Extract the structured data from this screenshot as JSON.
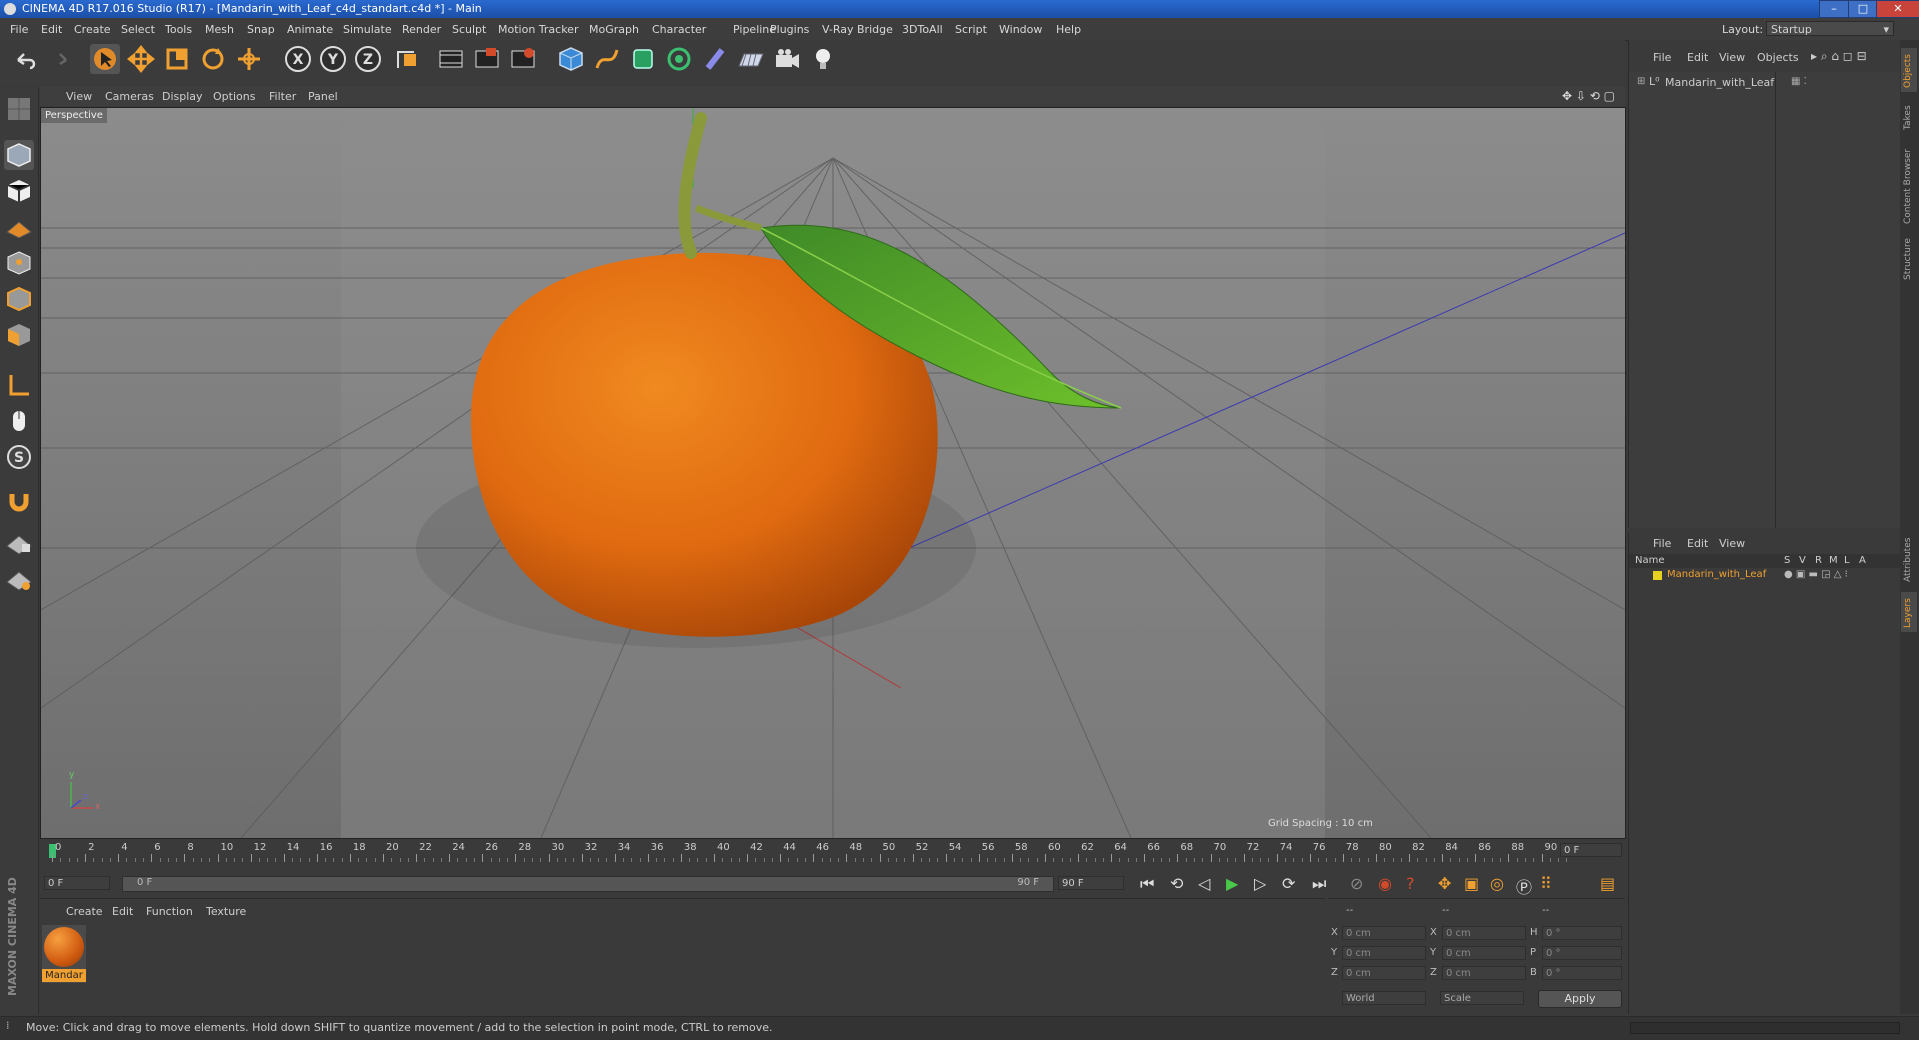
{
  "window": {
    "title": "CINEMA 4D R17.016 Studio (R17) - [Mandarin_with_Leaf_c4d_standart.c4d *] - Main",
    "minimize": "–",
    "maximize": "□",
    "close": "✕"
  },
  "menu": [
    "File",
    "Edit",
    "Create",
    "Select",
    "Tools",
    "Mesh",
    "Snap",
    "Animate",
    "Simulate",
    "Render",
    "Sculpt",
    "Motion Tracker",
    "MoGraph",
    "Character",
    "Pipeline",
    "Plugins",
    "V-Ray Bridge",
    "3DToAll",
    "Script",
    "Window",
    "Help"
  ],
  "layout": {
    "label": "Layout:",
    "value": "Startup"
  },
  "viewport": {
    "menu": [
      "View",
      "Cameras",
      "Display",
      "Options",
      "Filter",
      "Panel"
    ],
    "label": "Perspective",
    "grid_spacing": "Grid Spacing : 10 cm",
    "axis_y": "y",
    "axis_x": "x",
    "axis_z": "z"
  },
  "timeline": {
    "ticks": [
      "0",
      "2",
      "4",
      "6",
      "8",
      "10",
      "12",
      "14",
      "16",
      "18",
      "20",
      "22",
      "24",
      "26",
      "28",
      "30",
      "32",
      "34",
      "36",
      "38",
      "40",
      "42",
      "44",
      "46",
      "48",
      "50",
      "52",
      "54",
      "56",
      "58",
      "60",
      "62",
      "64",
      "66",
      "68",
      "70",
      "72",
      "74",
      "76",
      "78",
      "80",
      "82",
      "84",
      "86",
      "88",
      "90"
    ],
    "current_frame": "0 F",
    "start_field": "0 F",
    "range_start": "0 F",
    "range_end": "90 F",
    "end_field": "90 F"
  },
  "material_manager": {
    "menu": [
      "Create",
      "Edit",
      "Function",
      "Texture"
    ],
    "material_name": "Mandar"
  },
  "coordinates": {
    "headers": [
      "--",
      "--",
      "--"
    ],
    "rows": [
      {
        "a": "X",
        "av": "0 cm",
        "b": "X",
        "bv": "0 cm",
        "c": "H",
        "cv": "0 °"
      },
      {
        "a": "Y",
        "av": "0 cm",
        "b": "Y",
        "bv": "0 cm",
        "c": "P",
        "cv": "0 °"
      },
      {
        "a": "Z",
        "av": "0 cm",
        "b": "Z",
        "bv": "0 cm",
        "c": "B",
        "cv": "0 °"
      }
    ],
    "world": "World",
    "scale": "Scale",
    "apply": "Apply"
  },
  "objects_panel": {
    "menu": [
      "File",
      "Edit",
      "View",
      "Objects"
    ],
    "object_name": "Mandarin_with_Leaf"
  },
  "layers_panel": {
    "menu": [
      "File",
      "Edit",
      "View"
    ],
    "columns": [
      "Name",
      "S",
      "V",
      "R",
      "M",
      "L",
      "A"
    ],
    "layer_name": "Mandarin_with_Leaf"
  },
  "side_tabs": [
    "Objects",
    "Takes",
    "Content Browser",
    "Structure"
  ],
  "side_tabs_lower": [
    "Attributes",
    "Layers"
  ],
  "branding": "MAXON CINEMA 4D",
  "status": "Move: Click and drag to move elements. Hold down SHIFT to quantize movement / add to the selection in point mode, CTRL to remove.",
  "colors": {
    "accent": "#f0a030",
    "title_blue": "#2a6ad0",
    "layer_yellow": "#e8d020"
  }
}
